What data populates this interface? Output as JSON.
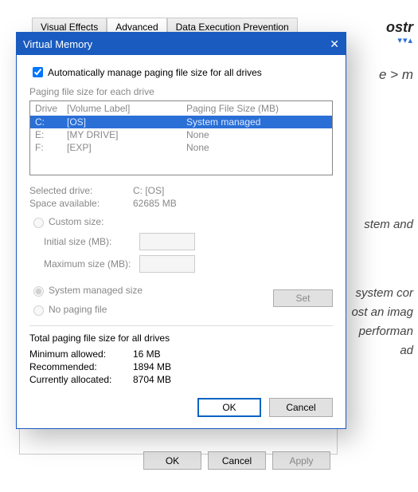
{
  "bg": {
    "ostr": "ostr",
    "vva": "▾▾▴",
    "crumb": "e > m",
    "para1a": "stem and",
    "para2a": "system cor",
    "para2b": "ost an imag",
    "para2c": "performan",
    "para2d": "ad",
    "tabs": {
      "visual": "Visual Effects",
      "advanced": "Advanced",
      "dep": "Data Execution Prevention"
    },
    "buttons": {
      "ok": "OK",
      "cancel": "Cancel",
      "apply": "Apply"
    }
  },
  "modal": {
    "title": "Virtual Memory",
    "auto_label": "Automatically manage paging file size for all drives",
    "group_label": "Paging file size for each drive",
    "header": {
      "drive": "Drive",
      "vol": "[Volume Label]",
      "size": "Paging File Size (MB)"
    },
    "rows": [
      {
        "drive": "C:",
        "label": "[OS]",
        "size": "System managed"
      },
      {
        "drive": "E:",
        "label": "[MY DRIVE]",
        "size": "None"
      },
      {
        "drive": "F:",
        "label": "[EXP]",
        "size": "None"
      }
    ],
    "selected_drive_label": "Selected drive:",
    "selected_drive_value": "C:  [OS]",
    "space_label": "Space available:",
    "space_value": "62685 MB",
    "custom_label": "Custom size:",
    "initial_label": "Initial size (MB):",
    "max_label": "Maximum size (MB):",
    "sys_managed_label": "System managed size",
    "no_paging_label": "No paging file",
    "set_label": "Set",
    "totals_title": "Total paging file size for all drives",
    "min_label": "Minimum allowed:",
    "min_value": "16 MB",
    "rec_label": "Recommended:",
    "rec_value": "1894 MB",
    "cur_label": "Currently allocated:",
    "cur_value": "8704 MB",
    "ok": "OK",
    "cancel": "Cancel"
  }
}
